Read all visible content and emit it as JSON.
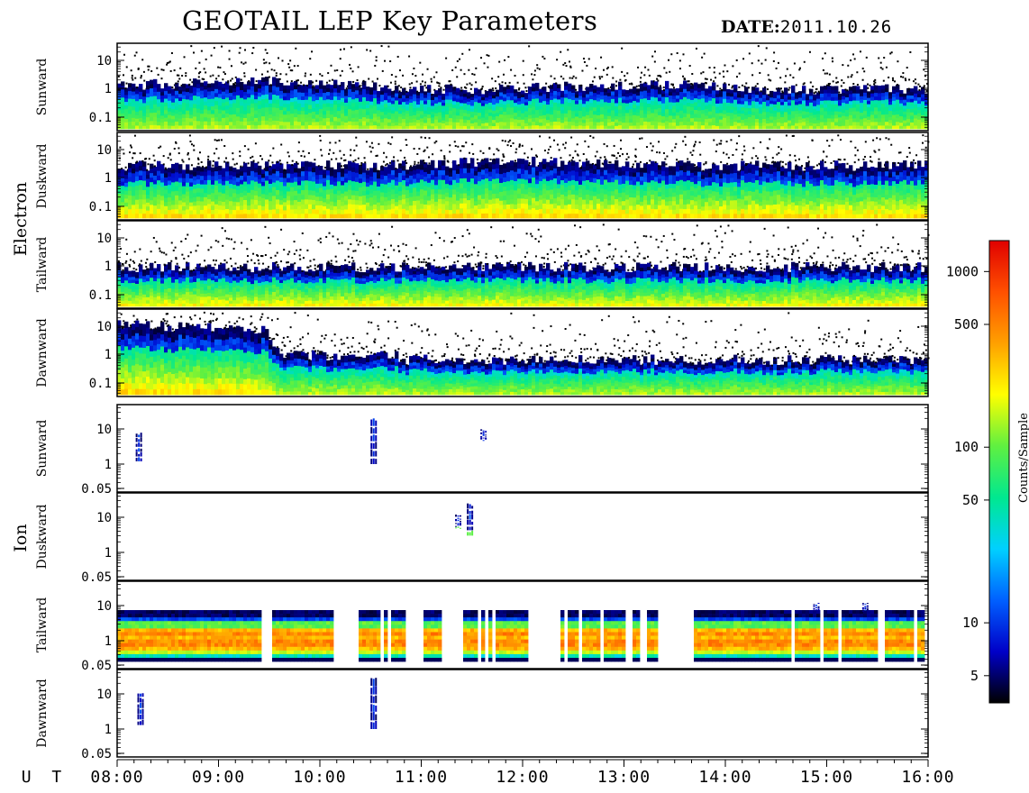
{
  "title": "GEOTAIL LEP Key Parameters",
  "date_label": "DATE:",
  "date_value": "2011.10.26",
  "ut_label": "U T",
  "chart_data": {
    "type": "heatmap",
    "title": "GEOTAIL LEP Key Parameters",
    "x": {
      "label": "U T",
      "range": [
        "08:00",
        "16:00"
      ],
      "ticks": [
        "08:00",
        "09:00",
        "10:00",
        "11:00",
        "12:00",
        "13:00",
        "14:00",
        "15:00",
        "16:00"
      ]
    },
    "groups": [
      {
        "name": "Electron",
        "panels": [
          {
            "name": "Sunward",
            "y_scale": "log",
            "y_ticks": [
              "10",
              "1",
              "0.1"
            ]
          },
          {
            "name": "Duskward",
            "y_scale": "log",
            "y_ticks": [
              "10",
              "1",
              "0.1"
            ]
          },
          {
            "name": "Tailward",
            "y_scale": "log",
            "y_ticks": [
              "10",
              "1",
              "0.1"
            ]
          },
          {
            "name": "Dawnward",
            "y_scale": "log",
            "y_ticks": [
              "10",
              "1",
              "0.1"
            ]
          }
        ]
      },
      {
        "name": "Ion",
        "panels": [
          {
            "name": "Sunward",
            "y_scale": "log",
            "y_ticks": [
              "10",
              "1",
              "0.05"
            ]
          },
          {
            "name": "Duskward",
            "y_scale": "log",
            "y_ticks": [
              "10",
              "1",
              "0.05"
            ]
          },
          {
            "name": "Tailward",
            "y_scale": "log",
            "y_ticks": [
              "10",
              "1",
              "0.05"
            ]
          },
          {
            "name": "Dawnward",
            "y_scale": "log",
            "y_ticks": [
              "10",
              "1",
              "0.05"
            ]
          }
        ]
      }
    ],
    "colorbar": {
      "label": "Counts/Sample",
      "scale": "log",
      "range": [
        3.5,
        1500
      ],
      "ticks": [
        {
          "value": 1000,
          "label": "1000"
        },
        {
          "value": 500,
          "label": "500"
        },
        {
          "value": 100,
          "label": "100"
        },
        {
          "value": 50,
          "label": "50"
        },
        {
          "value": 10,
          "label": "10"
        },
        {
          "value": 5,
          "label": "5"
        }
      ],
      "colors": [
        "#000000",
        "#0000c8",
        "#0060ff",
        "#00d0ff",
        "#00e890",
        "#60f040",
        "#ffff00",
        "#ffa000",
        "#ff5000",
        "#e00000"
      ]
    },
    "electron_profiles": {
      "Sunward": [
        [
          0.0,
          0.5,
          0.07,
          0.5
        ],
        [
          0.22,
          0.55,
          0.07,
          0.55
        ],
        [
          0.3,
          0.5,
          0.07,
          0.55
        ],
        [
          0.35,
          0.45,
          0.07,
          0.45
        ],
        [
          0.45,
          0.45,
          0.07,
          0.45
        ],
        [
          0.6,
          0.5,
          0.07,
          0.45
        ],
        [
          0.7,
          0.5,
          0.07,
          0.45
        ],
        [
          0.8,
          0.45,
          0.07,
          0.45
        ],
        [
          1.0,
          0.45,
          0.07,
          0.45
        ]
      ],
      "Duskward": [
        [
          0.0,
          0.6,
          0.55,
          0.45
        ],
        [
          0.3,
          0.6,
          0.55,
          0.45
        ],
        [
          0.5,
          0.65,
          0.55,
          0.5
        ],
        [
          0.7,
          0.6,
          0.55,
          0.45
        ],
        [
          1.0,
          0.6,
          0.55,
          0.45
        ]
      ],
      "Tailward": [
        [
          0.0,
          0.45,
          0.4,
          0.45
        ],
        [
          0.35,
          0.45,
          0.4,
          0.45
        ],
        [
          0.55,
          0.45,
          0.35,
          0.45
        ],
        [
          0.77,
          0.45,
          0.3,
          0.45
        ],
        [
          1.0,
          0.45,
          0.45,
          0.45
        ]
      ],
      "Dawnward": [
        [
          0.0,
          0.8,
          0.6,
          0.85
        ],
        [
          0.18,
          0.75,
          0.45,
          0.85
        ],
        [
          0.2,
          0.45,
          0.1,
          0.45
        ],
        [
          0.34,
          0.45,
          0.1,
          0.45
        ],
        [
          0.35,
          0.4,
          0.05,
          0.4
        ],
        [
          1.0,
          0.4,
          0.05,
          0.4
        ]
      ]
    },
    "ion_tailward_gaps": [
      [
        "09:25",
        "09:31"
      ],
      [
        "10:08",
        "10:22"
      ],
      [
        "10:36",
        "10:38"
      ],
      [
        "10:40",
        "10:42"
      ],
      [
        "10:51",
        "10:54"
      ],
      [
        "10:56",
        "11:01"
      ],
      [
        "11:13",
        "11:24"
      ],
      [
        "11:33",
        "11:35"
      ],
      [
        "11:37",
        "11:39"
      ],
      [
        "11:42",
        "11:45"
      ],
      [
        "12:03",
        "12:22"
      ],
      [
        "12:25",
        "12:26"
      ],
      [
        "12:28",
        "12:29"
      ],
      [
        "12:33",
        "12:35"
      ],
      [
        "12:46",
        "12:47"
      ],
      [
        "13:00",
        "13:05"
      ],
      [
        "13:10",
        "13:14"
      ],
      [
        "13:19",
        "13:41"
      ],
      [
        "14:40",
        "14:42"
      ],
      [
        "14:56",
        "14:58"
      ],
      [
        "15:07",
        "15:09"
      ],
      [
        "15:31",
        "15:34"
      ],
      [
        "15:52",
        "15:54"
      ]
    ],
    "ion_bursts": [
      {
        "panel": "Sunward",
        "time": "08:11",
        "y": [
          1.2,
          8
        ]
      },
      {
        "panel": "Sunward",
        "time": "10:30",
        "y": [
          1.0,
          20
        ]
      },
      {
        "panel": "Sunward",
        "time": "11:35",
        "y": [
          5,
          10
        ]
      },
      {
        "panel": "Duskward",
        "time": "11:20",
        "y": [
          5,
          12
        ]
      },
      {
        "panel": "Duskward",
        "time": "11:27",
        "y": [
          3,
          25
        ]
      },
      {
        "panel": "Tailward",
        "time": "14:52",
        "y": [
          8,
          12
        ]
      },
      {
        "panel": "Tailward",
        "time": "15:21",
        "y": [
          8,
          12
        ]
      },
      {
        "panel": "Dawnward",
        "time": "08:12",
        "y": [
          1.3,
          12
        ]
      },
      {
        "panel": "Dawnward",
        "time": "10:30",
        "y": [
          1.0,
          30
        ]
      }
    ]
  }
}
